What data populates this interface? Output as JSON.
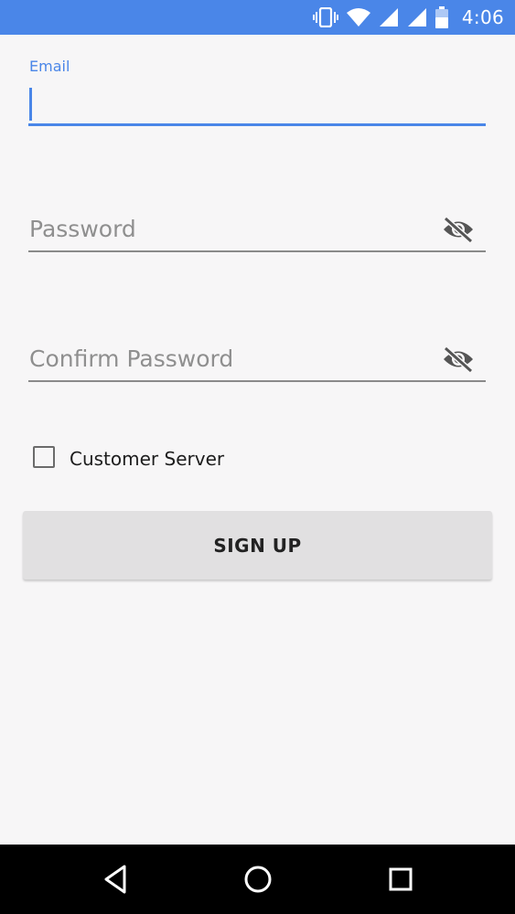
{
  "status_bar": {
    "time": "4:06",
    "icons": [
      "vibrate-icon",
      "wifi-icon",
      "signal-icon",
      "signal-icon",
      "battery-icon"
    ],
    "background": "#4a86e8"
  },
  "form": {
    "email_label": "Email",
    "email_value": "",
    "password_placeholder": "Password",
    "confirm_password_placeholder": "Confirm Password",
    "checkbox_label": "Customer Server",
    "checkbox_checked": false,
    "signup_label": "SIGN UP",
    "accent_color": "#4a86e8"
  },
  "nav_bar": {
    "icons": [
      "back-icon",
      "home-icon",
      "recents-icon"
    ]
  }
}
